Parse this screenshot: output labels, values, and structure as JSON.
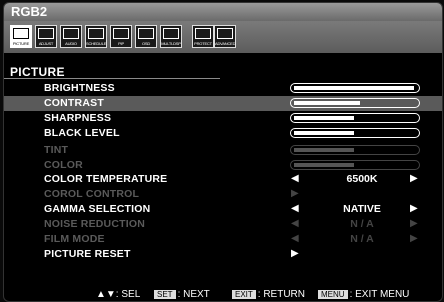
{
  "window": {
    "title": "RGB2"
  },
  "tabs": [
    {
      "label": "PICTURE",
      "icon": "picture-icon",
      "selected": true
    },
    {
      "label": "ADJUST",
      "icon": "adjust-icon"
    },
    {
      "label": "AUDIO",
      "icon": "audio-icon"
    },
    {
      "label": "SCHEDULE",
      "icon": "schedule-icon"
    },
    {
      "label": "PIP",
      "icon": "pip-icon"
    },
    {
      "label": "OSD",
      "icon": "osd-icon"
    },
    {
      "label": "MULTI-DSP",
      "icon": "multi-dsp-icon"
    },
    {
      "label": "PROTECT",
      "icon": "protect-icon"
    },
    {
      "label": "ADVANCED",
      "icon": "advanced-icon"
    }
  ],
  "section": {
    "title": "PICTURE"
  },
  "items": [
    {
      "label": "BRIGHTNESS",
      "type": "slider",
      "level": 1.0
    },
    {
      "label": "CONTRAST",
      "type": "slider",
      "level": 0.55,
      "highlight": true
    },
    {
      "label": "SHARPNESS",
      "type": "slider",
      "level": 0.5
    },
    {
      "label": "BLACK LEVEL",
      "type": "slider",
      "level": 0.5
    },
    {
      "label": "TINT",
      "type": "slider",
      "level": 0.5,
      "disabled": true
    },
    {
      "label": "COLOR",
      "type": "slider",
      "level": 0.5,
      "disabled": true
    },
    {
      "label": "COLOR TEMPERATURE",
      "type": "select",
      "value": "6500K"
    },
    {
      "label": "COROL CONTROL",
      "type": "submenu",
      "disabled": true
    },
    {
      "label": "GAMMA SELECTION",
      "type": "select",
      "value": "NATIVE"
    },
    {
      "label": "NOISE REDUCTION",
      "type": "select",
      "value": "N / A",
      "disabled": true
    },
    {
      "label": "FILM MODE",
      "type": "select",
      "value": "N / A",
      "disabled": true
    },
    {
      "label": "PICTURE RESET",
      "type": "submenu"
    }
  ],
  "footer": {
    "sel": "▲▼: SEL",
    "set_key": "SET",
    "set_text": ": NEXT",
    "exit_key": "EXIT",
    "exit_text": ": RETURN",
    "menu_key": "MENU",
    "menu_text": ": EXIT MENU"
  }
}
